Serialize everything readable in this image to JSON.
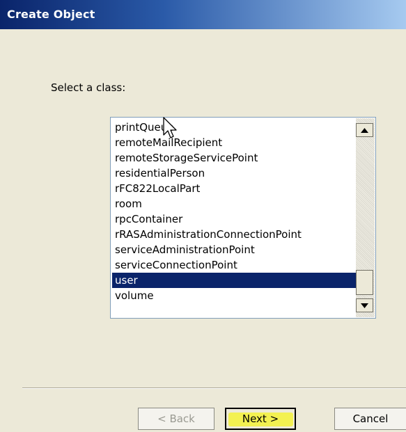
{
  "window": {
    "title": "Create Object"
  },
  "prompt": "Select a class:",
  "class_list": {
    "items": [
      "printQueue",
      "remoteMailRecipient",
      "remoteStorageServicePoint",
      "residentialPerson",
      "rFC822LocalPart",
      "room",
      "rpcContainer",
      "rRASAdministrationConnectionPoint",
      "serviceAdministrationPoint",
      "serviceConnectionPoint",
      "user",
      "volume"
    ],
    "selected": "user"
  },
  "buttons": {
    "back": "< Back",
    "next": "Next >",
    "cancel": "Cancel"
  },
  "colors": {
    "selection": "#0a246a",
    "highlight": "#f5f23a",
    "dialog_bg": "#ece9d8"
  }
}
